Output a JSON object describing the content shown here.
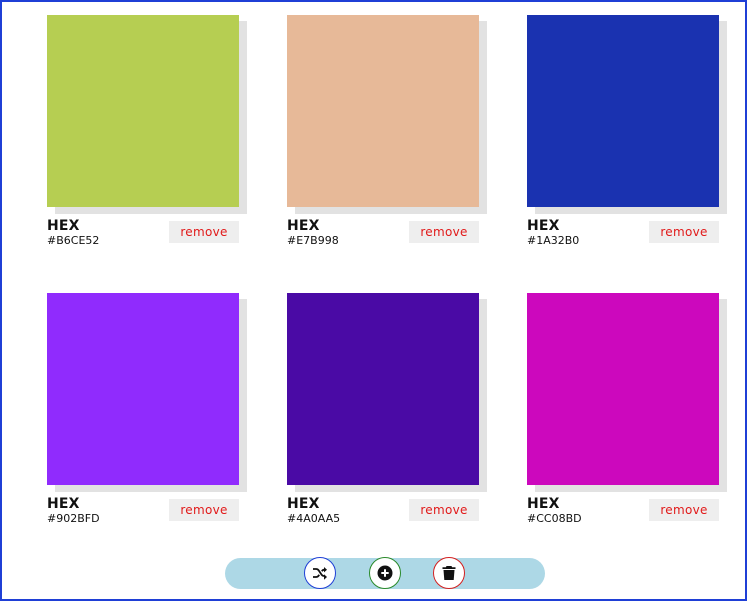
{
  "palette": {
    "colors": [
      {
        "label": "HEX",
        "value": "#B6CE52",
        "swatch": "#B6CE52",
        "remove_label": "remove"
      },
      {
        "label": "HEX",
        "value": "#E7B998",
        "swatch": "#E7B998",
        "remove_label": "remove"
      },
      {
        "label": "HEX",
        "value": "#1A32B0",
        "swatch": "#1A32B0",
        "remove_label": "remove"
      },
      {
        "label": "HEX",
        "value": "#902BFD",
        "swatch": "#902BFD",
        "remove_label": "remove"
      },
      {
        "label": "HEX",
        "value": "#4A0AA5",
        "swatch": "#4A0AA5",
        "remove_label": "remove"
      },
      {
        "label": "HEX",
        "value": "#CC08BD",
        "swatch": "#CC08BD",
        "remove_label": "remove"
      }
    ]
  },
  "toolbar": {
    "buttons": [
      {
        "icon": "shuffle-icon",
        "border_color": "#1f3fd6"
      },
      {
        "icon": "add-circle-icon",
        "border_color": "#2a8a2a"
      },
      {
        "icon": "trash-icon",
        "border_color": "#d42020"
      }
    ]
  },
  "colors": {
    "toolbar_bg": "#ADD8E6",
    "remove_text": "#E11A1A",
    "remove_bg": "#EEEEEE",
    "frame_border": "#1F3FD6"
  }
}
